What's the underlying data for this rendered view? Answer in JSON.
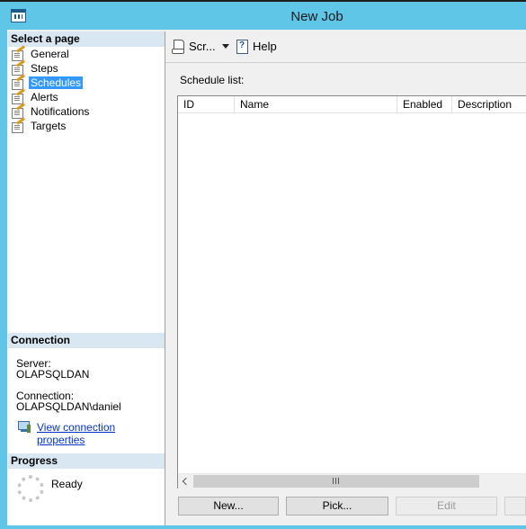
{
  "window": {
    "title": "New Job"
  },
  "left": {
    "select_page_header": "Select a page",
    "pages": [
      {
        "label": "General",
        "selected": false
      },
      {
        "label": "Steps",
        "selected": false
      },
      {
        "label": "Schedules",
        "selected": true
      },
      {
        "label": "Alerts",
        "selected": false
      },
      {
        "label": "Notifications",
        "selected": false
      },
      {
        "label": "Targets",
        "selected": false
      }
    ],
    "connection": {
      "header": "Connection",
      "server_label": "Server:",
      "server_value": "OLAPSQLDAN",
      "connection_label": "Connection:",
      "connection_value": "OLAPSQLDAN\\daniel",
      "link": "View connection properties"
    },
    "progress": {
      "header": "Progress",
      "status": "Ready"
    }
  },
  "toolbar": {
    "script_label": "Scr...",
    "help_label": "Help"
  },
  "main": {
    "schedule_list_label": "Schedule list:",
    "columns": [
      "ID",
      "Name",
      "Enabled",
      "Description"
    ],
    "rows": []
  },
  "buttons": {
    "new": "New...",
    "pick": "Pick...",
    "edit": "Edit",
    "remove": ""
  },
  "colors": {
    "title_bar": "#5fc6e8",
    "selection": "#3399ff",
    "section_header": "#d9e7f3",
    "link": "#0033cc"
  }
}
